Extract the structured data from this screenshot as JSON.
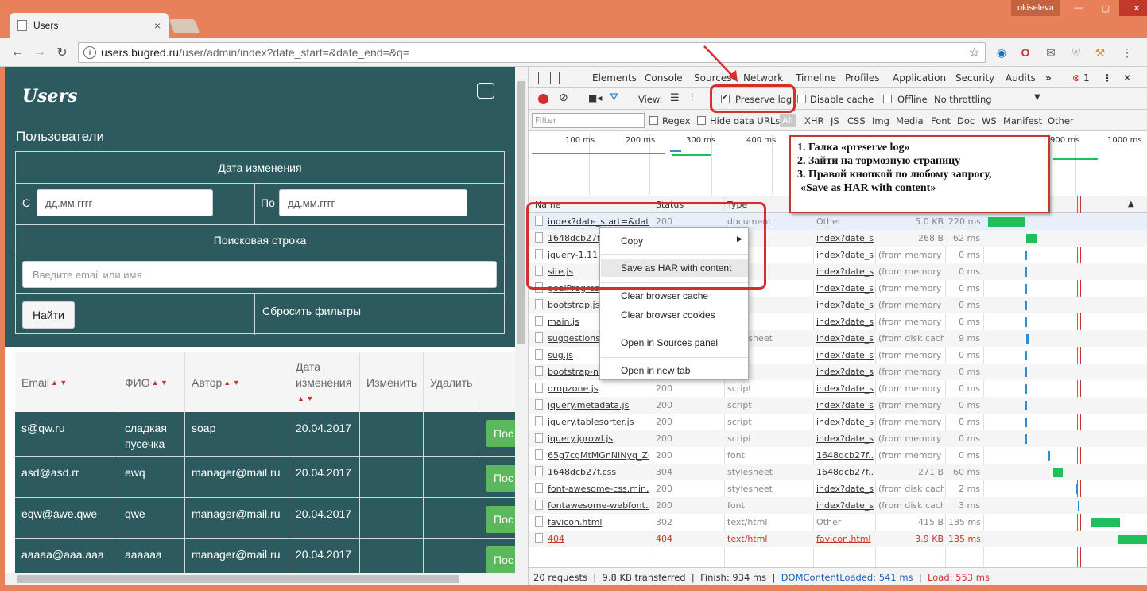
{
  "browser": {
    "tab_title": "Users",
    "tab_close": "×",
    "user": "okiseleva",
    "url_host": "users.bugred.ru",
    "url_path": "/user/admin/index?date_start=&date_end=&q=",
    "win_min": "—",
    "win_max": "▢",
    "win_close": "✕"
  },
  "app": {
    "logo": "Users",
    "page_title": "Пользователи",
    "filter": {
      "date_header": "Дата изменения",
      "from_label": "С",
      "from_placeholder": "дд.мм.гггг",
      "to_label": "По",
      "to_placeholder": "дд.мм.гггг",
      "search_header": "Поисковая строка",
      "search_placeholder": "Введите email или имя",
      "find_button": "Найти",
      "reset_link": "Сбросить фильтры"
    },
    "table": {
      "headers": [
        "Email",
        "ФИО",
        "Автор",
        "Дата изменения",
        "Изменить",
        "Удалить"
      ],
      "rows": [
        {
          "email": "s@qw.ru",
          "fio": "сладкая пусечка",
          "author": "soap",
          "date": "20.04.2017",
          "btn": "Пос"
        },
        {
          "email": "asd@asd.rr",
          "fio": "ewq",
          "author": "manager@mail.ru",
          "date": "20.04.2017",
          "btn": "Пос"
        },
        {
          "email": "eqw@awe.qwe",
          "fio": "qwe",
          "author": "manager@mail.ru",
          "date": "20.04.2017",
          "btn": "Пос"
        },
        {
          "email": "aaaaa@aaa.aaa",
          "fio": "aaaaaa",
          "author": "manager@mail.ru",
          "date": "20.04.2017",
          "btn": "Пос"
        }
      ]
    }
  },
  "devtools": {
    "tabs": [
      "Elements",
      "Console",
      "Sources",
      "Network",
      "Timeline",
      "Profiles",
      "Application",
      "Security",
      "Audits",
      "»"
    ],
    "error_count": "1",
    "toolbar": {
      "view_label": "View:",
      "preserve_log": "Preserve log",
      "disable_cache": "Disable cache",
      "offline": "Offline",
      "throttling": "No throttling"
    },
    "filterbar": {
      "filter_placeholder": "Filter",
      "regex": "Regex",
      "hide_data_urls": "Hide data URLs",
      "types": [
        "All",
        "XHR",
        "JS",
        "CSS",
        "Img",
        "Media",
        "Font",
        "Doc",
        "WS",
        "Manifest",
        "Other"
      ]
    },
    "overview_ticks": [
      "100 ms",
      "200 ms",
      "300 ms",
      "400 ms",
      "900 ms",
      "1000 ms"
    ],
    "columns": [
      "Name",
      "Status",
      "Type"
    ],
    "requests": [
      {
        "name": "index?date_start=&date...",
        "status": "200",
        "type": "document",
        "initiator": "Other",
        "size": "5.0 KB",
        "time": "220 ms"
      },
      {
        "name": "1648dcb27f.js",
        "status": "",
        "type": "",
        "initiator": "index?date_s...",
        "size": "268 B",
        "time": "62 ms"
      },
      {
        "name": "jquery-1.11.2...",
        "status": "",
        "type": "",
        "initiator": "index?date_s...",
        "size": "(from memory ...",
        "time": "0 ms"
      },
      {
        "name": "site.js",
        "status": "",
        "type": "",
        "initiator": "index?date_s...",
        "size": "(from memory ...",
        "time": "0 ms"
      },
      {
        "name": "goalProgress...",
        "status": "",
        "type": "",
        "initiator": "index?date_s...",
        "size": "(from memory ...",
        "time": "0 ms"
      },
      {
        "name": "bootstrap.js",
        "status": "",
        "type": "",
        "initiator": "index?date_s...",
        "size": "(from memory ...",
        "time": "0 ms"
      },
      {
        "name": "main.js",
        "status": "",
        "type": "",
        "initiator": "index?date_s...",
        "size": "(from memory ...",
        "time": "0 ms"
      },
      {
        "name": "suggestions.c...",
        "status": "",
        "type": "stylesheet",
        "initiator": "index?date_s...",
        "size": "(from disk cach...",
        "time": "9 ms"
      },
      {
        "name": "sug.js",
        "status": "",
        "type": "",
        "initiator": "index?date_s...",
        "size": "(from memory ...",
        "time": "0 ms"
      },
      {
        "name": "bootstrap-no...",
        "status": "",
        "type": "",
        "initiator": "index?date_s...",
        "size": "(from memory ...",
        "time": "0 ms"
      },
      {
        "name": "dropzone.js",
        "status": "200",
        "type": "script",
        "initiator": "index?date_s...",
        "size": "(from memory ...",
        "time": "0 ms"
      },
      {
        "name": "jquery.metadata.js",
        "status": "200",
        "type": "script",
        "initiator": "index?date_s...",
        "size": "(from memory ...",
        "time": "0 ms"
      },
      {
        "name": "jquery.tablesorter.js",
        "status": "200",
        "type": "script",
        "initiator": "index?date_s...",
        "size": "(from memory ...",
        "time": "0 ms"
      },
      {
        "name": "jquery.jgrowl.js",
        "status": "200",
        "type": "script",
        "initiator": "index?date_s...",
        "size": "(from memory ...",
        "time": "0 ms"
      },
      {
        "name": "65g7cgMtMGnNINyq_Z6...",
        "status": "200",
        "type": "font",
        "initiator": "1648dcb27f...",
        "size": "(from memory ...",
        "time": "0 ms"
      },
      {
        "name": "1648dcb27f.css",
        "status": "304",
        "type": "stylesheet",
        "initiator": "1648dcb27f...",
        "size": "271 B",
        "time": "60 ms"
      },
      {
        "name": "font-awesome-css.min.css",
        "status": "200",
        "type": "stylesheet",
        "initiator": "index?date_s...",
        "size": "(from disk cach...",
        "time": "2 ms"
      },
      {
        "name": "fontawesome-webfont.w...",
        "status": "200",
        "type": "font",
        "initiator": "index?date_s...",
        "size": "(from disk cach...",
        "time": "3 ms"
      },
      {
        "name": "favicon.html",
        "status": "302",
        "type": "text/html",
        "initiator": "Other",
        "size": "415 B",
        "time": "185 ms"
      },
      {
        "name": "404",
        "status": "404",
        "type": "text/html",
        "initiator": "favicon.html",
        "size": "3.9 KB",
        "time": "135 ms"
      }
    ],
    "status_bar": {
      "requests": "20 requests",
      "transferred": "9.8 KB transferred",
      "finish": "Finish: 934 ms",
      "dcl": "DOMContentLoaded: 541 ms",
      "load": "Load: 553 ms"
    },
    "context_menu": [
      "Copy",
      "Save as HAR with content",
      "Clear browser cache",
      "Clear browser cookies",
      "Open in Sources panel",
      "Open in new tab"
    ]
  },
  "annotation": {
    "line1": "1. Галка «preserve log»",
    "line2": "2. Зайти на тормозную страницу",
    "line3": "3. Правой кнопкой по любому запросу,",
    "line4": "«Save as HAR with content»"
  },
  "colors": {
    "app_bg": "#2d5a5e",
    "accent_red": "#d32f2f",
    "waterfall_green": "#1fbf5a",
    "waterfall_blue": "#2b8ed6"
  }
}
